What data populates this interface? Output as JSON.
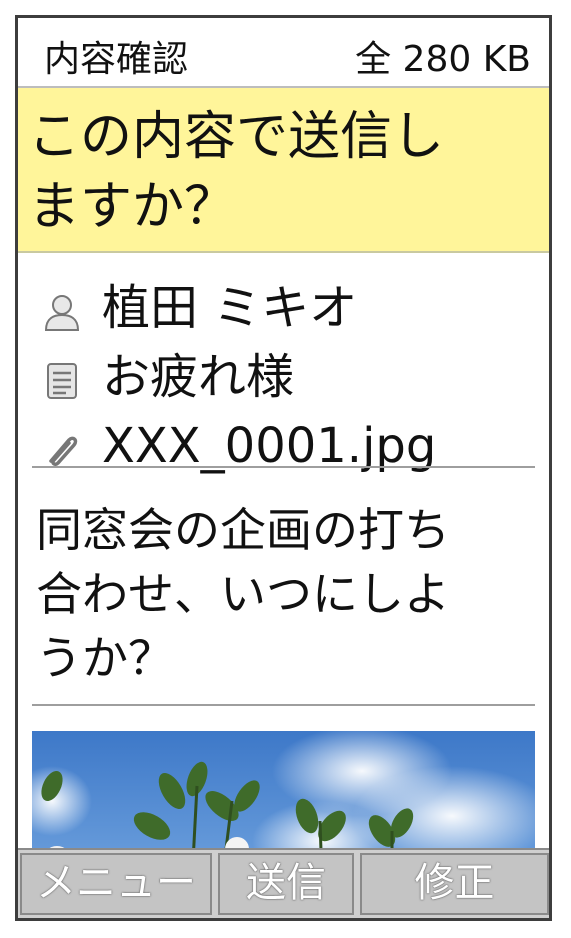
{
  "header": {
    "title": "内容確認",
    "size": "全 280 KB"
  },
  "question": {
    "line1": "この内容で送信し",
    "line2": "ますか？"
  },
  "details": {
    "recipient": {
      "icon": "person-icon",
      "name": "植田 ミキオ"
    },
    "subject": {
      "icon": "document-icon",
      "text": "お疲れ様"
    },
    "attachment": {
      "icon": "paperclip-icon",
      "filename": "XXX_0001.jpg"
    }
  },
  "message": {
    "line1": "同窓会の企画の打ち",
    "line2": "合わせ、いつにしよ",
    "line3": "うか？"
  },
  "softkeys": {
    "left": "メニュー",
    "center": "送信",
    "right": "修正"
  },
  "colors": {
    "highlight": "#fff59a",
    "softkey": "#c4c4c4"
  }
}
